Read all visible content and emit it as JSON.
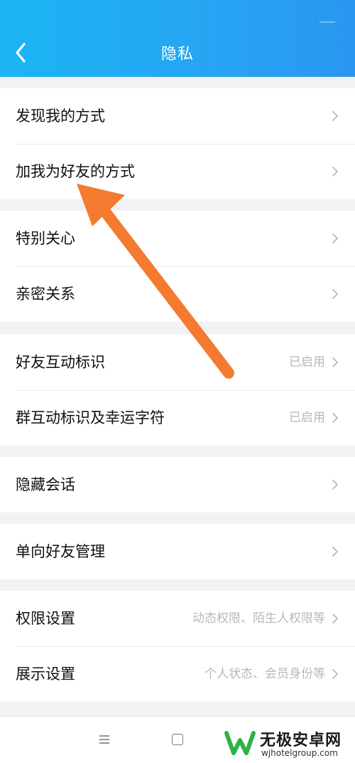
{
  "header": {
    "title": "隐私",
    "back_icon": "chevron-left-icon"
  },
  "groups": [
    {
      "items": [
        {
          "label": "发现我的方式",
          "value": ""
        },
        {
          "label": "加我为好友的方式",
          "value": ""
        }
      ]
    },
    {
      "items": [
        {
          "label": "特别关心",
          "value": ""
        },
        {
          "label": "亲密关系",
          "value": ""
        }
      ]
    },
    {
      "items": [
        {
          "label": "好友互动标识",
          "value": "已启用"
        },
        {
          "label": "群互动标识及幸运字符",
          "value": "已启用"
        }
      ]
    },
    {
      "items": [
        {
          "label": "隐藏会话",
          "value": ""
        }
      ]
    },
    {
      "items": [
        {
          "label": "单向好友管理",
          "value": ""
        }
      ]
    },
    {
      "items": [
        {
          "label": "权限设置",
          "value": "动态权限、陌生人权限等"
        },
        {
          "label": "展示设置",
          "value": "个人状态、会员身份等"
        }
      ]
    }
  ],
  "navbar": {
    "menu_icon": "menu-icon",
    "home_icon": "square-home-icon"
  },
  "watermark": {
    "title": "无极安卓网",
    "url": "wjhotelgroup.com"
  },
  "colors": {
    "header_start": "#1bb5f4",
    "header_end": "#2a97f0",
    "annotation_arrow": "#f47a30",
    "watermark_green": "#2bb34a"
  }
}
